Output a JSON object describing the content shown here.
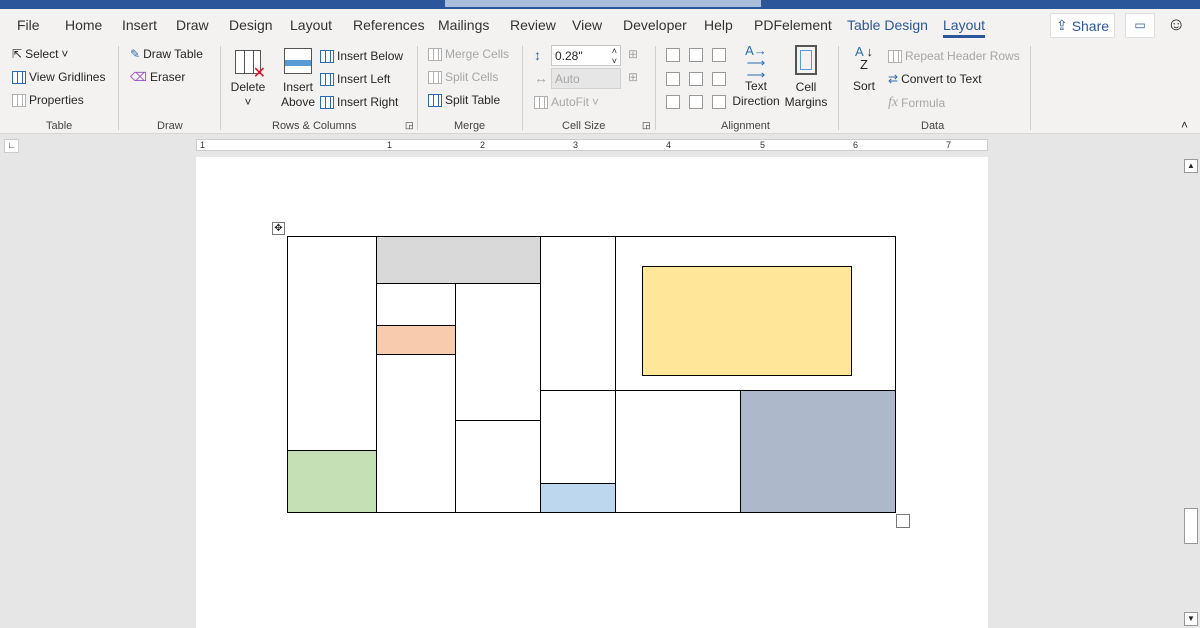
{
  "tabs": [
    "File",
    "Home",
    "Insert",
    "Draw",
    "Design",
    "Layout",
    "References",
    "Mailings",
    "Review",
    "View",
    "Developer",
    "Help",
    "PDFelement",
    "Table Design",
    "Layout"
  ],
  "share": "Share",
  "table_group": {
    "select": "Select",
    "gridlines": "View Gridlines",
    "properties": "Properties",
    "label": "Table"
  },
  "draw_group": {
    "draw_table": "Draw Table",
    "eraser": "Eraser",
    "label": "Draw"
  },
  "rows_group": {
    "delete": "Delete",
    "insert_above_1": "Insert",
    "insert_above_2": "Above",
    "insert_below": "Insert Below",
    "insert_left": "Insert Left",
    "insert_right": "Insert Right",
    "label": "Rows & Columns"
  },
  "merge_group": {
    "merge": "Merge Cells",
    "split_cells": "Split Cells",
    "split_table": "Split Table",
    "label": "Merge"
  },
  "cell_size": {
    "height": "0.28\"",
    "width": "Auto",
    "autofit": "AutoFit",
    "label": "Cell Size"
  },
  "alignment": {
    "text_dir_1": "Text",
    "text_dir_2": "Direction",
    "margins_1": "Cell",
    "margins_2": "Margins",
    "label": "Alignment"
  },
  "data_group": {
    "sort": "Sort",
    "repeat": "Repeat Header Rows",
    "convert": "Convert to Text",
    "formula": "Formula",
    "label": "Data"
  },
  "ruler": [
    "1",
    "1",
    "2",
    "3",
    "4",
    "5",
    "6",
    "7"
  ],
  "colors": {
    "accent": "#2b579a",
    "gray": "#d9d9d9",
    "peach": "#f8cbad",
    "green": "#c5e0b4",
    "blue": "#bdd7ee",
    "slate": "#adb9ca",
    "yellow": "#ffe699"
  }
}
